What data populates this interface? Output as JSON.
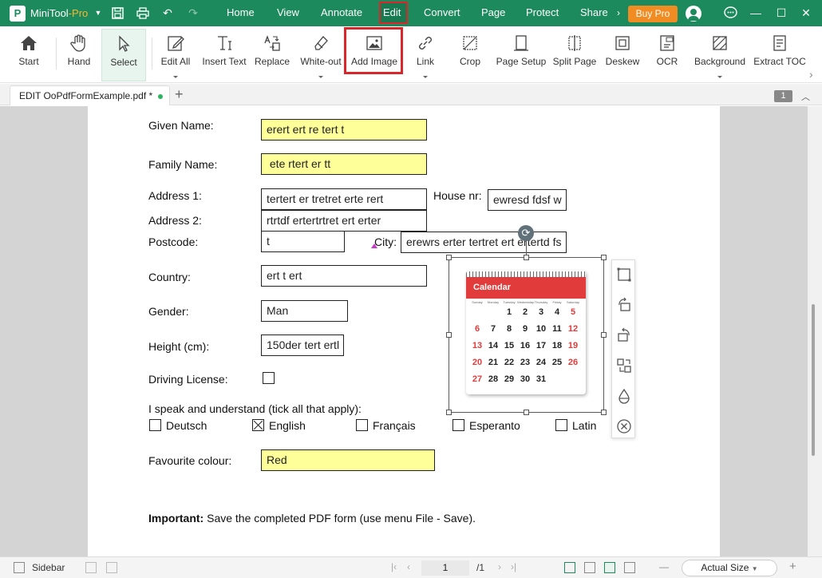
{
  "app": {
    "name": "MiniTool",
    "name_suffix": "-Pro",
    "logo_text": "P",
    "buy_label": "Buy Pro"
  },
  "menu": [
    "Home",
    "View",
    "Annotate",
    "Edit",
    "Convert",
    "Page",
    "Protect",
    "Share"
  ],
  "menu_active": "Edit",
  "ribbon": [
    {
      "key": "start",
      "label": "Start",
      "icon": "home-icon"
    },
    {
      "key": "hand",
      "label": "Hand",
      "icon": "hand-icon"
    },
    {
      "key": "select",
      "label": "Select",
      "icon": "cursor-icon"
    },
    {
      "key": "edit-all",
      "label": "Edit All",
      "icon": "edit-icon"
    },
    {
      "key": "insert-text",
      "label": "Insert Text",
      "icon": "text-icon"
    },
    {
      "key": "replace",
      "label": "Replace",
      "icon": "replace-icon"
    },
    {
      "key": "white-out",
      "label": "White-out",
      "icon": "eraser-icon"
    },
    {
      "key": "add-image",
      "label": "Add Image",
      "icon": "image-icon"
    },
    {
      "key": "link",
      "label": "Link",
      "icon": "link-icon"
    },
    {
      "key": "crop",
      "label": "Crop",
      "icon": "crop-icon"
    },
    {
      "key": "page-setup",
      "label": "Page Setup",
      "icon": "page-setup-icon"
    },
    {
      "key": "split-page",
      "label": "Split Page",
      "icon": "split-icon"
    },
    {
      "key": "deskew",
      "label": "Deskew",
      "icon": "deskew-icon"
    },
    {
      "key": "ocr",
      "label": "OCR",
      "icon": "ocr-icon"
    },
    {
      "key": "background",
      "label": "Background",
      "icon": "background-icon"
    },
    {
      "key": "extract-toc",
      "label": "Extract TOC",
      "icon": "toc-icon"
    }
  ],
  "tab": {
    "title": "EDIT OoPdfFormExample.pdf *",
    "page_badge": "1"
  },
  "form": {
    "given_name": {
      "label": "Given Name:",
      "value": "erert ert re tert t"
    },
    "family_name": {
      "label": "Family Name:",
      "value": " ete rtert er tt"
    },
    "address1": {
      "label": "Address 1:",
      "value": "tertert er tretret  erte rert"
    },
    "house_nr": {
      "label": "House nr:",
      "value": "ewresd fdsf w"
    },
    "address2": {
      "label": "Address 2:",
      "value": "rtrtdf ertertrtret ert erter"
    },
    "postcode": {
      "label": "Postcode:",
      "value": "t"
    },
    "city": {
      "label": "City:",
      "value": "erewrs erter tertret ert ertertd fs"
    },
    "country": {
      "label": "Country:",
      "value": "ert t ert"
    },
    "gender": {
      "label": "Gender:",
      "value": "Man"
    },
    "height": {
      "label": "Height (cm):",
      "value": "150der tert ertl"
    },
    "driving": {
      "label": "Driving License:"
    },
    "languages_label": "I speak and understand (tick all that apply):",
    "languages": [
      {
        "label": "Deutsch",
        "checked": false
      },
      {
        "label": "English",
        "checked": true
      },
      {
        "label": "Français",
        "checked": false
      },
      {
        "label": "Esperanto",
        "checked": false
      },
      {
        "label": "Latin",
        "checked": false
      }
    ],
    "colour": {
      "label": "Favourite colour:",
      "value": "Red"
    },
    "important_bold": "Important:",
    "important_text": " Save the completed PDF form (use menu File - Save)."
  },
  "calendar": {
    "title": "Calendar",
    "dow": [
      "Sunday",
      "Monday",
      "Tuesday",
      "Wednesday",
      "Thursday",
      "Friday",
      "Saturday"
    ],
    "weeks": [
      [
        "",
        "",
        "1",
        "2",
        "3",
        "4",
        "5"
      ],
      [
        "6",
        "7",
        "8",
        "9",
        "10",
        "11",
        "12"
      ],
      [
        "13",
        "14",
        "15",
        "16",
        "17",
        "18",
        "19"
      ],
      [
        "20",
        "21",
        "22",
        "23",
        "24",
        "25",
        "26"
      ],
      [
        "27",
        "28",
        "29",
        "30",
        "31",
        "",
        ""
      ]
    ]
  },
  "image_tools": [
    "crop-icon",
    "rotate-left-icon",
    "rotate-right-icon",
    "replace-icon",
    "opacity-icon",
    "delete-icon"
  ],
  "status": {
    "sidebar_label": "Sidebar",
    "current_page": "1",
    "total_pages": "/1",
    "zoom": "Actual Size"
  },
  "colors": {
    "brand": "#1c8a5c",
    "highlight": "#d9262b",
    "field_yellow": "#ffff99",
    "calendar_red": "#e23b3b"
  }
}
